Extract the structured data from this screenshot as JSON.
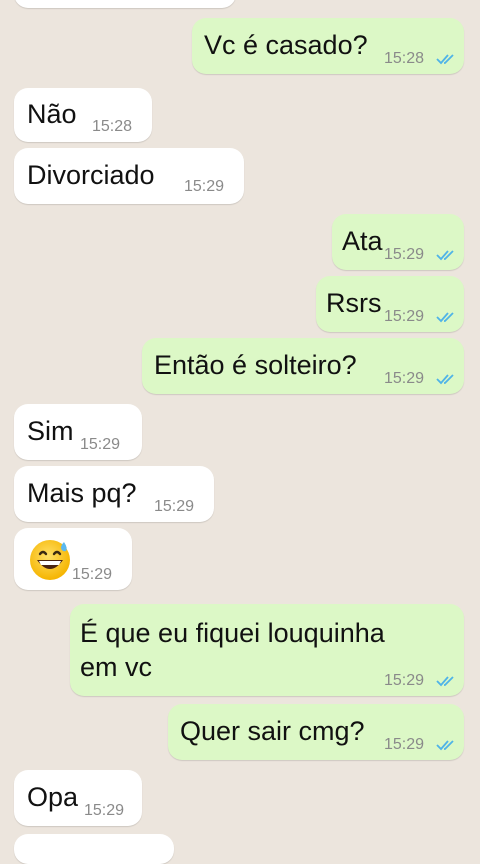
{
  "colors": {
    "wallpaper": "#ece5dd",
    "incoming_bubble": "#ffffff",
    "outgoing_bubble": "#dcf8c6",
    "read_ticks": "#4fb3e8",
    "timestamp": "#8a8a8a"
  },
  "messages": [
    {
      "direction": "in",
      "text": "",
      "time": ""
    },
    {
      "direction": "out",
      "text": "Vc é casado?",
      "time": "15:28",
      "status": "read"
    },
    {
      "direction": "in",
      "text": "Não",
      "time": "15:28"
    },
    {
      "direction": "in",
      "text": "Divorciado",
      "time": "15:29"
    },
    {
      "direction": "out",
      "text": "Ata",
      "time": "15:29",
      "status": "read"
    },
    {
      "direction": "out",
      "text": "Rsrs",
      "time": "15:29",
      "status": "read"
    },
    {
      "direction": "out",
      "text": "Então é solteiro?",
      "time": "15:29",
      "status": "read"
    },
    {
      "direction": "in",
      "text": "Sim",
      "time": "15:29"
    },
    {
      "direction": "in",
      "text": "Mais pq?",
      "time": "15:29"
    },
    {
      "direction": "in",
      "text": "",
      "emoji": "grinning-face-with-sweat",
      "time": "15:29"
    },
    {
      "direction": "out",
      "text_lines": [
        "É que eu fiquei louquinha",
        "em vc"
      ],
      "time": "15:29",
      "status": "read"
    },
    {
      "direction": "out",
      "text": "Quer sair cmg?",
      "time": "15:29",
      "status": "read"
    },
    {
      "direction": "in",
      "text": "Opa",
      "time": "15:29"
    },
    {
      "direction": "in",
      "text": "",
      "time": ""
    }
  ]
}
